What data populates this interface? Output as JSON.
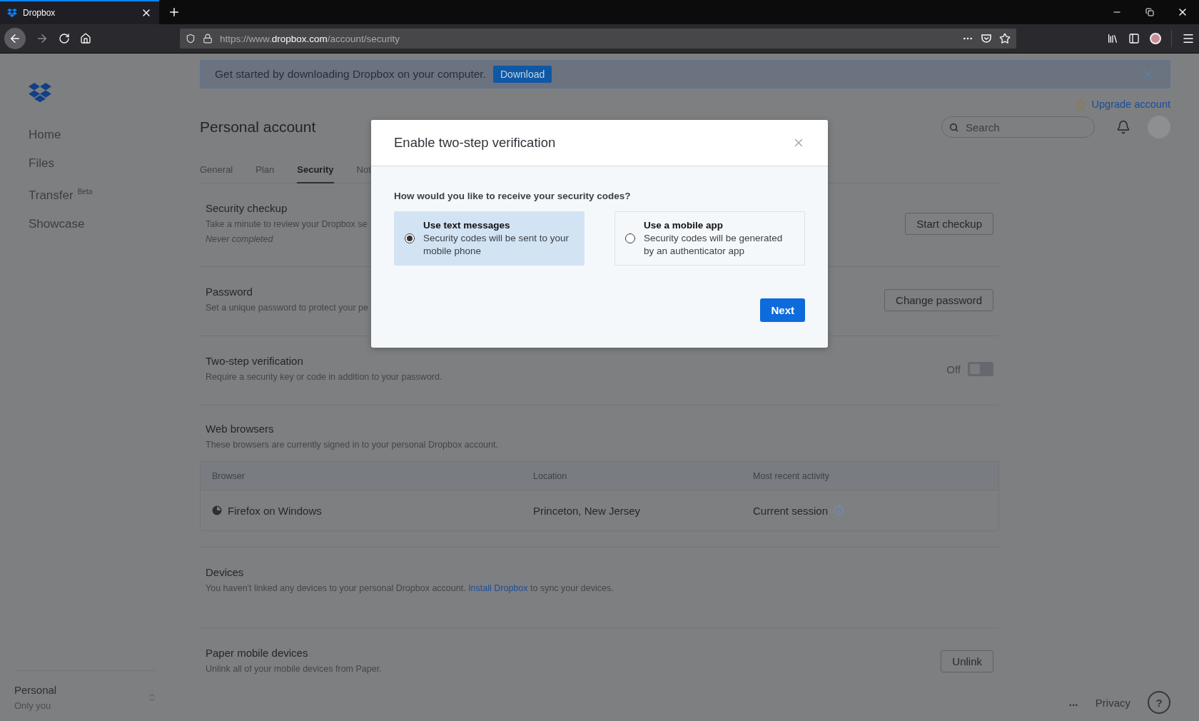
{
  "browser": {
    "tab_title": "Dropbox",
    "url_prefix": "https://www.",
    "url_domain": "dropbox.com",
    "url_path": "/account/security"
  },
  "sidebar": {
    "items": [
      {
        "label": "Home"
      },
      {
        "label": "Files"
      },
      {
        "label": "Transfer",
        "badge": "Beta"
      },
      {
        "label": "Showcase"
      }
    ],
    "account": {
      "name": "Personal",
      "subtitle": "Only you"
    }
  },
  "banner": {
    "text": "Get started by downloading Dropbox on your computer.",
    "button": "Download"
  },
  "header": {
    "upgrade": "Upgrade account",
    "search_placeholder": "Search",
    "title": "Personal account"
  },
  "tabs": [
    {
      "label": "General",
      "selected": false
    },
    {
      "label": "Plan",
      "selected": false
    },
    {
      "label": "Security",
      "selected": true
    },
    {
      "label": "Not",
      "selected": false
    }
  ],
  "sections": [
    {
      "kind": "button",
      "title": "Security checkup",
      "description": "Take a minute to review your Dropbox se",
      "note": "Never completed",
      "button": "Start checkup"
    },
    {
      "kind": "button",
      "title": "Password",
      "description": "Set a unique password to protect your pe",
      "button": "Change password"
    },
    {
      "kind": "toggle",
      "title": "Two-step verification",
      "description": "Require a security key or code in addition to your password.",
      "toggle": {
        "label": "Off",
        "on": false
      }
    },
    {
      "kind": "table",
      "title": "Web browsers",
      "description": "These browsers are currently signed in to your personal Dropbox account.",
      "table": {
        "columns": [
          "Browser",
          "Location",
          "Most recent activity"
        ],
        "rows": [
          {
            "cells": [
              "Firefox on Windows",
              "Princeton, New Jersey",
              "Current session"
            ]
          }
        ]
      }
    },
    {
      "kind": "link",
      "title": "Devices",
      "description": "You haven't linked any devices to your personal Dropbox account.",
      "link": "Install Dropbox",
      "description_after": "to sync your devices."
    },
    {
      "kind": "button",
      "title": "Paper mobile devices",
      "description": "Unlink all of your mobile devices from Paper.",
      "button": "Unlink"
    }
  ],
  "footer": {
    "more": "...",
    "privacy": "Privacy",
    "help": "?"
  },
  "modal": {
    "title": "Enable two-step verification",
    "question": "How would you like to receive your security codes?",
    "options": [
      {
        "title": "Use text messages",
        "description": "Security codes will be sent to your mobile phone",
        "selected": true
      },
      {
        "title": "Use a mobile app",
        "description": "Security codes will be generated by an authenticator app",
        "selected": false
      }
    ],
    "button": "Next"
  }
}
